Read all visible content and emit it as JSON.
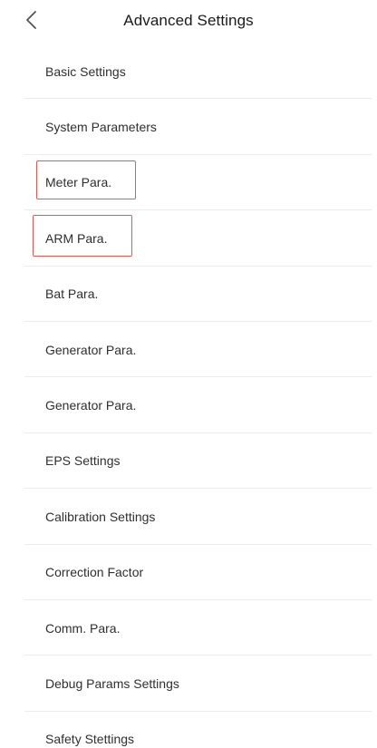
{
  "header": {
    "title": "Advanced Settings",
    "back_icon": "chevron-left-icon"
  },
  "menu": {
    "items": [
      {
        "label": "Basic Settings"
      },
      {
        "label": "System Parameters"
      },
      {
        "label": "Meter Para."
      },
      {
        "label": "ARM Para."
      },
      {
        "label": "Bat Para."
      },
      {
        "label": "Generator Para."
      },
      {
        "label": "Generator Para."
      },
      {
        "label": "EPS Settings"
      },
      {
        "label": "Calibration Settings"
      },
      {
        "label": "Correction Factor"
      },
      {
        "label": "Comm. Para."
      },
      {
        "label": "Debug Params Settings"
      },
      {
        "label": "Safety Stettings"
      }
    ]
  },
  "colors": {
    "highlight": "#e8574f",
    "divider": "#ececec"
  }
}
